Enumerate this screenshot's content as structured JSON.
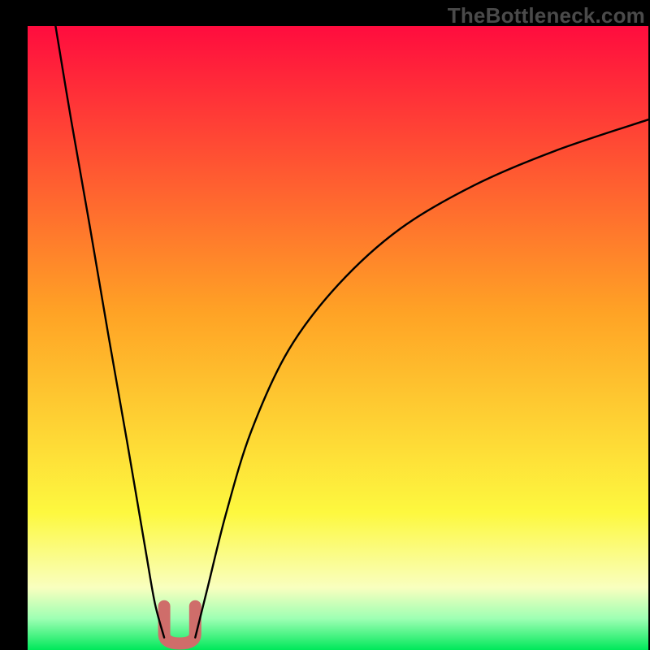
{
  "watermark": "TheBottleneck.com",
  "colors": {
    "top": "#ff0c3e",
    "mid": "#ffa325",
    "yellow": "#fdf83f",
    "pale": "#f9ffbf",
    "green_light": "#9dffb3",
    "green": "#00e85a",
    "curve": "#000000",
    "bump": "#cf6d6a",
    "frame": "#000000"
  },
  "chart_data": {
    "type": "line",
    "title": "",
    "xlabel": "",
    "ylabel": "",
    "xlim": [
      0,
      100
    ],
    "ylim": [
      0,
      100
    ],
    "notes": "Bottleneck-style curve: two branches descend to a minimum near x≈24. Left branch falls from top-left (x≈4.5,y≈100) to x≈22. Right branch rises from x≈27 toward top-right reaching y≈85 at x≈100. Green gradient band along the very bottom. Pink 'U' bump marks the minimum at x≈22–27, y≈0–7.",
    "series": [
      {
        "name": "left-branch",
        "x": [
          4.5,
          7,
          10,
          13,
          16,
          19,
          20.5,
          22
        ],
        "y": [
          100,
          85,
          68,
          50.5,
          33.5,
          16,
          7.5,
          2
        ]
      },
      {
        "name": "right-branch",
        "x": [
          27,
          29,
          32,
          36,
          42,
          50,
          60,
          72,
          85,
          100
        ],
        "y": [
          2,
          10,
          22,
          35,
          48,
          58.5,
          67.5,
          74.5,
          80,
          85
        ]
      }
    ],
    "bump": {
      "x_left": 22,
      "x_right": 27,
      "y_bottom": 0,
      "y_top": 7
    }
  }
}
